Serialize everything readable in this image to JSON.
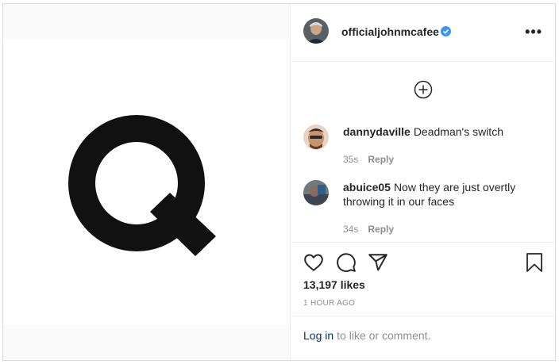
{
  "post": {
    "author": "officialjohnmcafee",
    "verified": true,
    "more_icon": "more-options-icon",
    "image_letter": "Q"
  },
  "comments": [
    {
      "username": "dannydaville",
      "text": "Deadman's switch",
      "age": "35s",
      "reply": "Reply"
    },
    {
      "username": "abuice05",
      "text": "Now they are just overtly throwing it in our faces",
      "age": "34s",
      "reply": "Reply"
    }
  ],
  "actions": {
    "icons": [
      "heart-icon",
      "comment-icon",
      "share-icon",
      "bookmark-icon"
    ]
  },
  "likes": "13,197 likes",
  "timestamp": "1 HOUR AGO",
  "login": {
    "link": "Log in",
    "rest": "to like or comment."
  },
  "colors": {
    "verified_blue": "#3897f0",
    "link_blue": "#00376b",
    "muted": "#8e8e8e"
  }
}
